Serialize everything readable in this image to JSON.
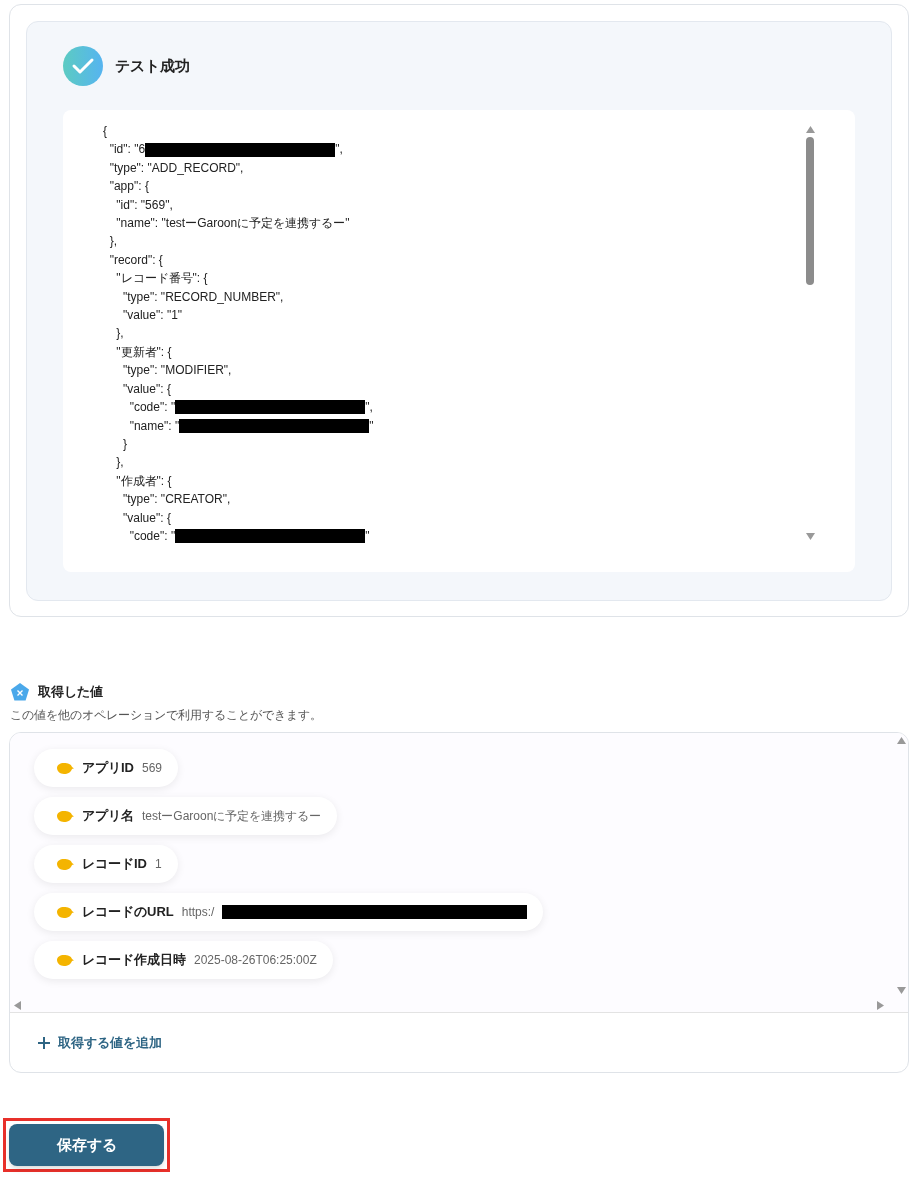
{
  "test_result": {
    "title": "テスト成功",
    "lines": [
      {
        "text": "{"
      },
      {
        "text": "  \"id\": \"6",
        "redacted": true,
        "after": "\","
      },
      {
        "text": "  \"type\": \"ADD_RECORD\","
      },
      {
        "text": "  \"app\": {"
      },
      {
        "text": "    \"id\": \"569\","
      },
      {
        "text": "    \"name\": \"testーGaroonに予定を連携するー\""
      },
      {
        "text": "  },"
      },
      {
        "text": "  \"record\": {"
      },
      {
        "text": "    \"レコード番号\": {"
      },
      {
        "text": "      \"type\": \"RECORD_NUMBER\","
      },
      {
        "text": "      \"value\": \"1\""
      },
      {
        "text": "    },"
      },
      {
        "text": "    \"更新者\": {"
      },
      {
        "text": "      \"type\": \"MODIFIER\","
      },
      {
        "text": "      \"value\": {"
      },
      {
        "text": "        \"code\": \"",
        "redacted": true,
        "after": "\","
      },
      {
        "text": "        \"name\": \"",
        "redacted": true,
        "after": "\""
      },
      {
        "text": "      }"
      },
      {
        "text": "    },"
      },
      {
        "text": "    \"作成者\": {"
      },
      {
        "text": "      \"type\": \"CREATOR\","
      },
      {
        "text": "      \"value\": {"
      },
      {
        "text": "        \"code\": \"",
        "redacted": true,
        "after": "\""
      }
    ]
  },
  "values_section": {
    "title": "取得した値",
    "description": "この値を他のオペレーションで利用することができます。",
    "items": [
      {
        "label": "アプリID",
        "value": "569"
      },
      {
        "label": "アプリ名",
        "value": "testーGaroonに予定を連携するー"
      },
      {
        "label": "レコードID",
        "value": "1"
      },
      {
        "label": "レコードのURL",
        "value": "https:/",
        "redacted": true
      },
      {
        "label": "レコード作成日時",
        "value": "2025-08-26T06:25:00Z"
      }
    ],
    "add_button": "取得する値を追加"
  },
  "save_button": "保存する"
}
